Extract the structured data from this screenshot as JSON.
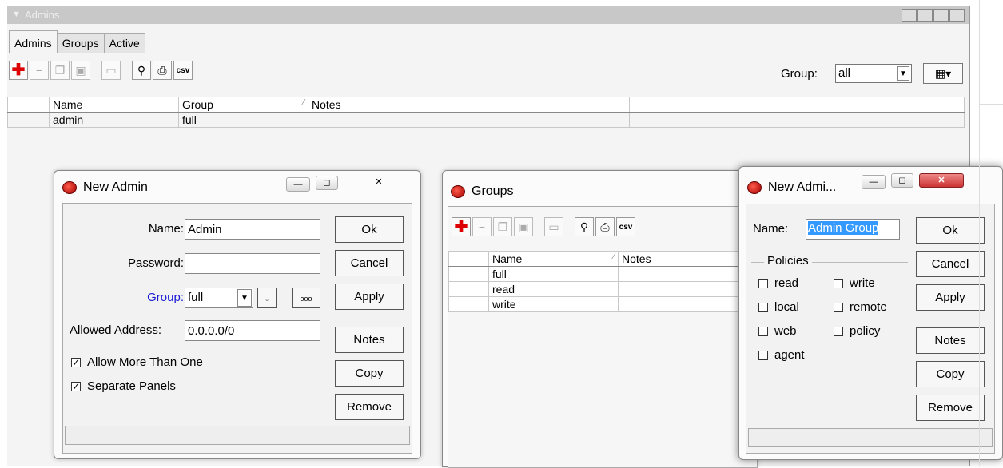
{
  "panel": {
    "title": "Admins"
  },
  "tabs": [
    "Admins",
    "Groups",
    "Active"
  ],
  "toolbar": {
    "csv": "csv"
  },
  "filter": {
    "label": "Group:",
    "value": "all"
  },
  "admins_table": {
    "headers": [
      "Name",
      "Group",
      "Notes"
    ],
    "rows": [
      {
        "name": "admin",
        "group": "full",
        "notes": ""
      }
    ]
  },
  "new_admin": {
    "title": "New Admin",
    "name_label": "Name:",
    "name_value": "Admin",
    "password_label": "Password:",
    "password_value": "",
    "group_label": "Group:",
    "group_value": "full",
    "address_label": "Allowed Address:",
    "address_value": "0.0.0.0/0",
    "allow_more": "Allow More Than One",
    "separate_panels": "Separate Panels",
    "buttons": {
      "ok": "Ok",
      "cancel": "Cancel",
      "apply": "Apply",
      "notes": "Notes",
      "copy": "Copy",
      "remove": "Remove"
    },
    "more_btn": "ooo"
  },
  "groups": {
    "title": "Groups",
    "headers": [
      "Name",
      "Notes"
    ],
    "rows": [
      "full",
      "read",
      "write"
    ]
  },
  "new_group": {
    "title": "New Admi...",
    "name_label": "Name:",
    "name_value": "Admin Group",
    "policies_label": "Policies",
    "policies": {
      "read": "read",
      "write": "write",
      "local": "local",
      "remote": "remote",
      "web": "web",
      "policy": "policy",
      "agent": "agent"
    },
    "buttons": {
      "ok": "Ok",
      "cancel": "Cancel",
      "apply": "Apply",
      "notes": "Notes",
      "copy": "Copy",
      "remove": "Remove"
    }
  },
  "colors": {
    "link_blue": "#1a1ad6",
    "selection": "#3399ff"
  }
}
